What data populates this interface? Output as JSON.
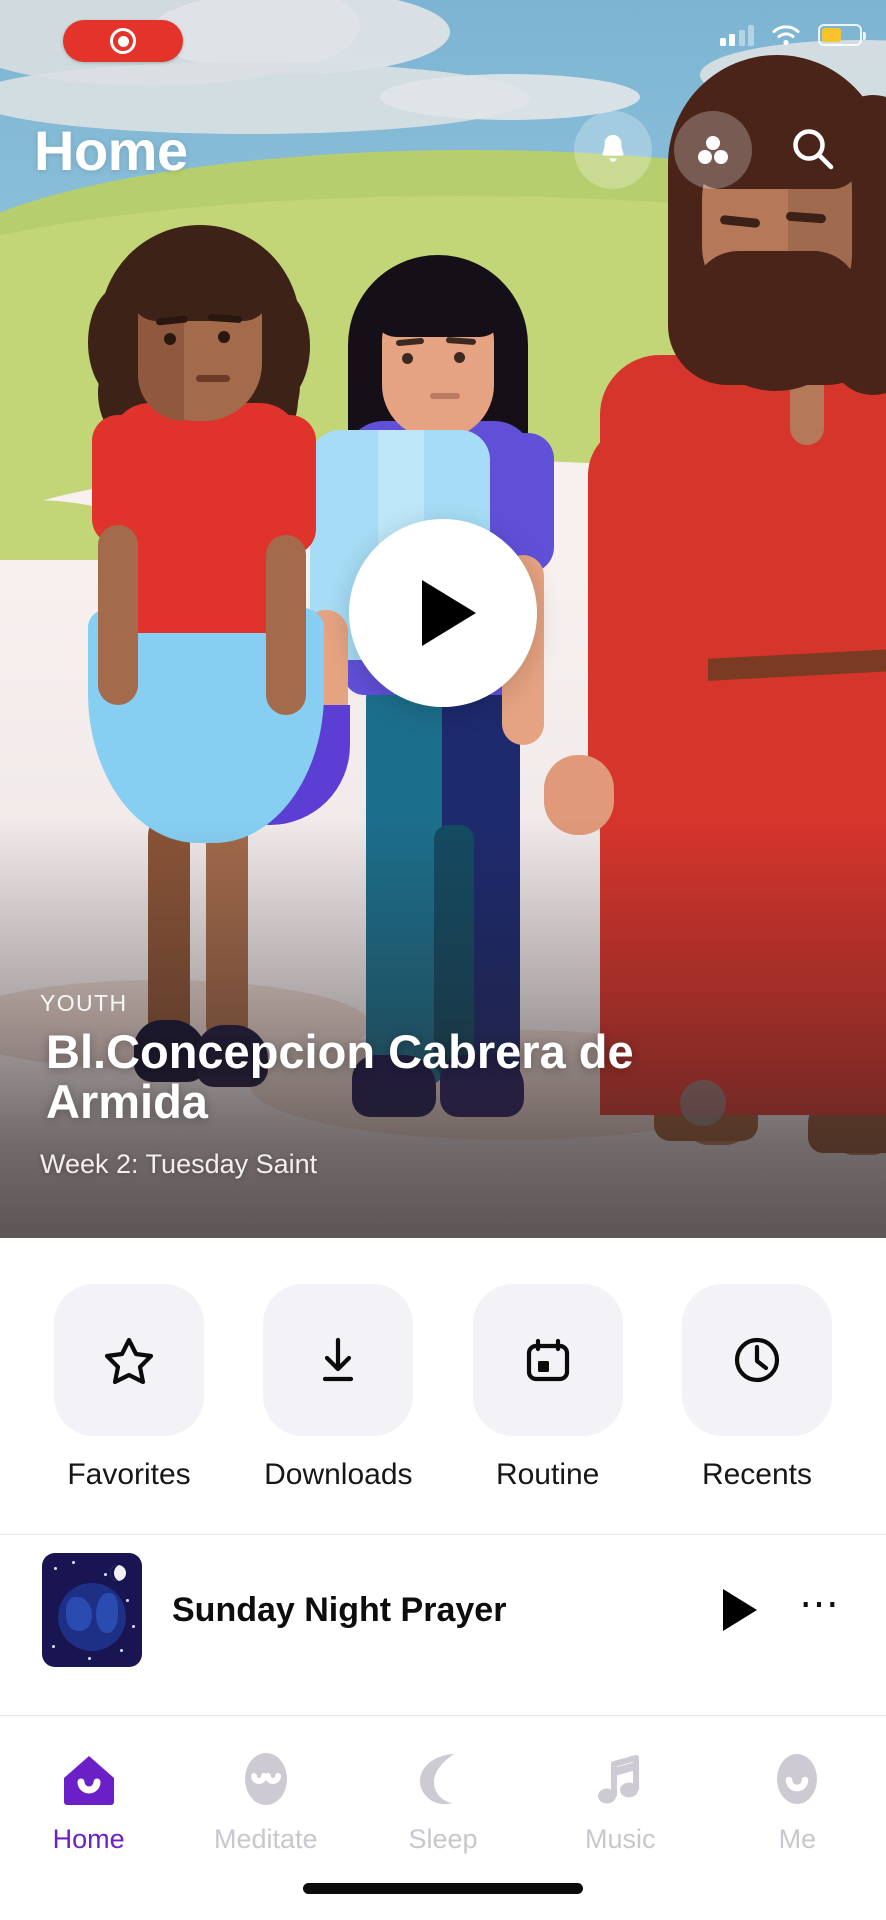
{
  "status_bar": {
    "recording_indicator": "screen-recording-active",
    "signal_bars_filled": 2,
    "signal_bars_total": 4,
    "wifi": "wifi-connected",
    "battery_level_percent": 52,
    "battery_color": "#f7c52b",
    "battery_low_power_mode": true
  },
  "header": {
    "title": "Home",
    "actions": [
      {
        "name": "notifications",
        "icon": "bell-icon"
      },
      {
        "name": "community",
        "icon": "community-dots-icon"
      },
      {
        "name": "search",
        "icon": "search-icon"
      }
    ]
  },
  "hero": {
    "kicker": "YOUTH",
    "title": "Bl.Concepcion Cabrera de Armida",
    "subtitle": "Week 2: Tuesday Saint",
    "play_button": "play-icon",
    "illustration": "children-walking-with-jesus"
  },
  "quick_actions": [
    {
      "label": "Favorites",
      "icon": "star-icon"
    },
    {
      "label": "Downloads",
      "icon": "download-icon"
    },
    {
      "label": "Routine",
      "icon": "calendar-icon"
    },
    {
      "label": "Recents",
      "icon": "clock-icon"
    }
  ],
  "playlist_row": {
    "title": "Sunday Night Prayer",
    "thumbnail": "night-earth-moon-thumbnail",
    "play_icon": "play-icon",
    "more_icon": "ellipsis-icon"
  },
  "tab_bar": {
    "active_color": "#6a1fc7",
    "inactive_color": "#c9c6cf",
    "items": [
      {
        "label": "Home",
        "icon": "home-icon",
        "active": true
      },
      {
        "label": "Meditate",
        "icon": "meditate-icon",
        "active": false
      },
      {
        "label": "Sleep",
        "icon": "moon-icon",
        "active": false
      },
      {
        "label": "Music",
        "icon": "music-note-icon",
        "active": false
      },
      {
        "label": "Me",
        "icon": "profile-icon",
        "active": false
      }
    ]
  },
  "home_indicator": "home-indicator-bar"
}
